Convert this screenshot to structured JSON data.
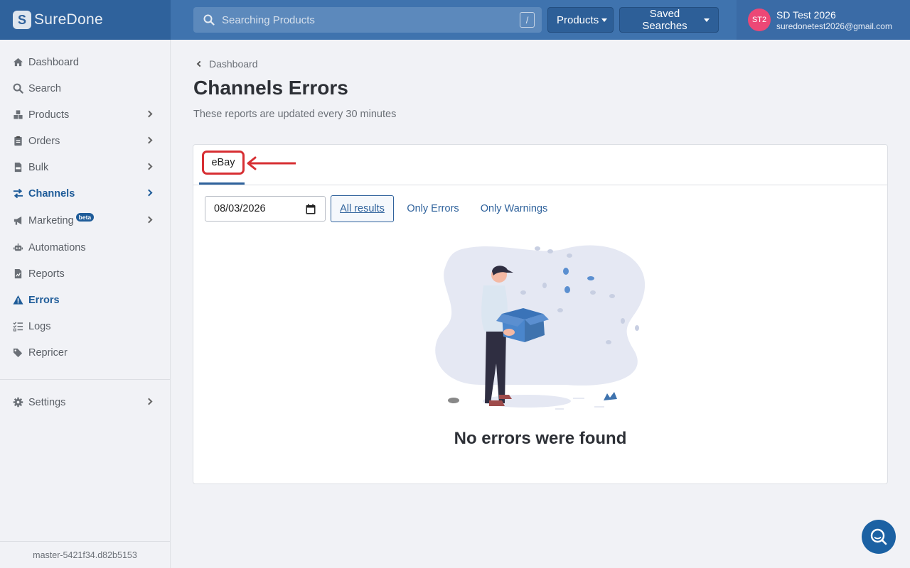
{
  "brand": {
    "logo_letter": "S",
    "name": "SureDone"
  },
  "search": {
    "placeholder": "Searching Products",
    "shortcut": "/"
  },
  "header": {
    "products_label": "Products",
    "saved_searches_label": "Saved Searches"
  },
  "user": {
    "initials": "ST2",
    "name": "SD Test 2026",
    "email": "suredonetest2026@gmail.com"
  },
  "sidebar": {
    "items": [
      {
        "label": "Dashboard",
        "icon": "home-icon"
      },
      {
        "label": "Search",
        "icon": "search-icon"
      },
      {
        "label": "Products",
        "icon": "cubes-icon"
      },
      {
        "label": "Orders",
        "icon": "clipboard-icon"
      },
      {
        "label": "Bulk",
        "icon": "csv-file-icon"
      },
      {
        "label": "Channels",
        "icon": "exchange-icon",
        "active": true
      },
      {
        "label": "Marketing",
        "icon": "bullhorn-icon",
        "badge": "beta"
      },
      {
        "label": "Automations",
        "icon": "robot-icon"
      },
      {
        "label": "Reports",
        "icon": "report-icon"
      },
      {
        "label": "Errors",
        "icon": "warning-icon",
        "active": true
      },
      {
        "label": "Logs",
        "icon": "tasks-icon"
      },
      {
        "label": "Repricer",
        "icon": "tags-icon"
      },
      {
        "label": "Settings",
        "icon": "gear-icon"
      }
    ],
    "version": "master-5421f34.d82b5153"
  },
  "breadcrumb": {
    "label": "Dashboard"
  },
  "page": {
    "title": "Channels Errors",
    "subtitle": "These reports are updated every 30 minutes"
  },
  "tabs": [
    {
      "label": "eBay",
      "active": true
    }
  ],
  "filters": {
    "date_value": "08/03/2026",
    "options": [
      {
        "label": "All results",
        "selected": true
      },
      {
        "label": "Only Errors",
        "selected": false
      },
      {
        "label": "Only Warnings",
        "selected": false
      }
    ]
  },
  "empty_state": {
    "message": "No errors were found"
  },
  "colors": {
    "primary": "#2f629c",
    "header": "#3f73ae",
    "annotation": "#d72f33",
    "avatar": "#ec4876"
  }
}
